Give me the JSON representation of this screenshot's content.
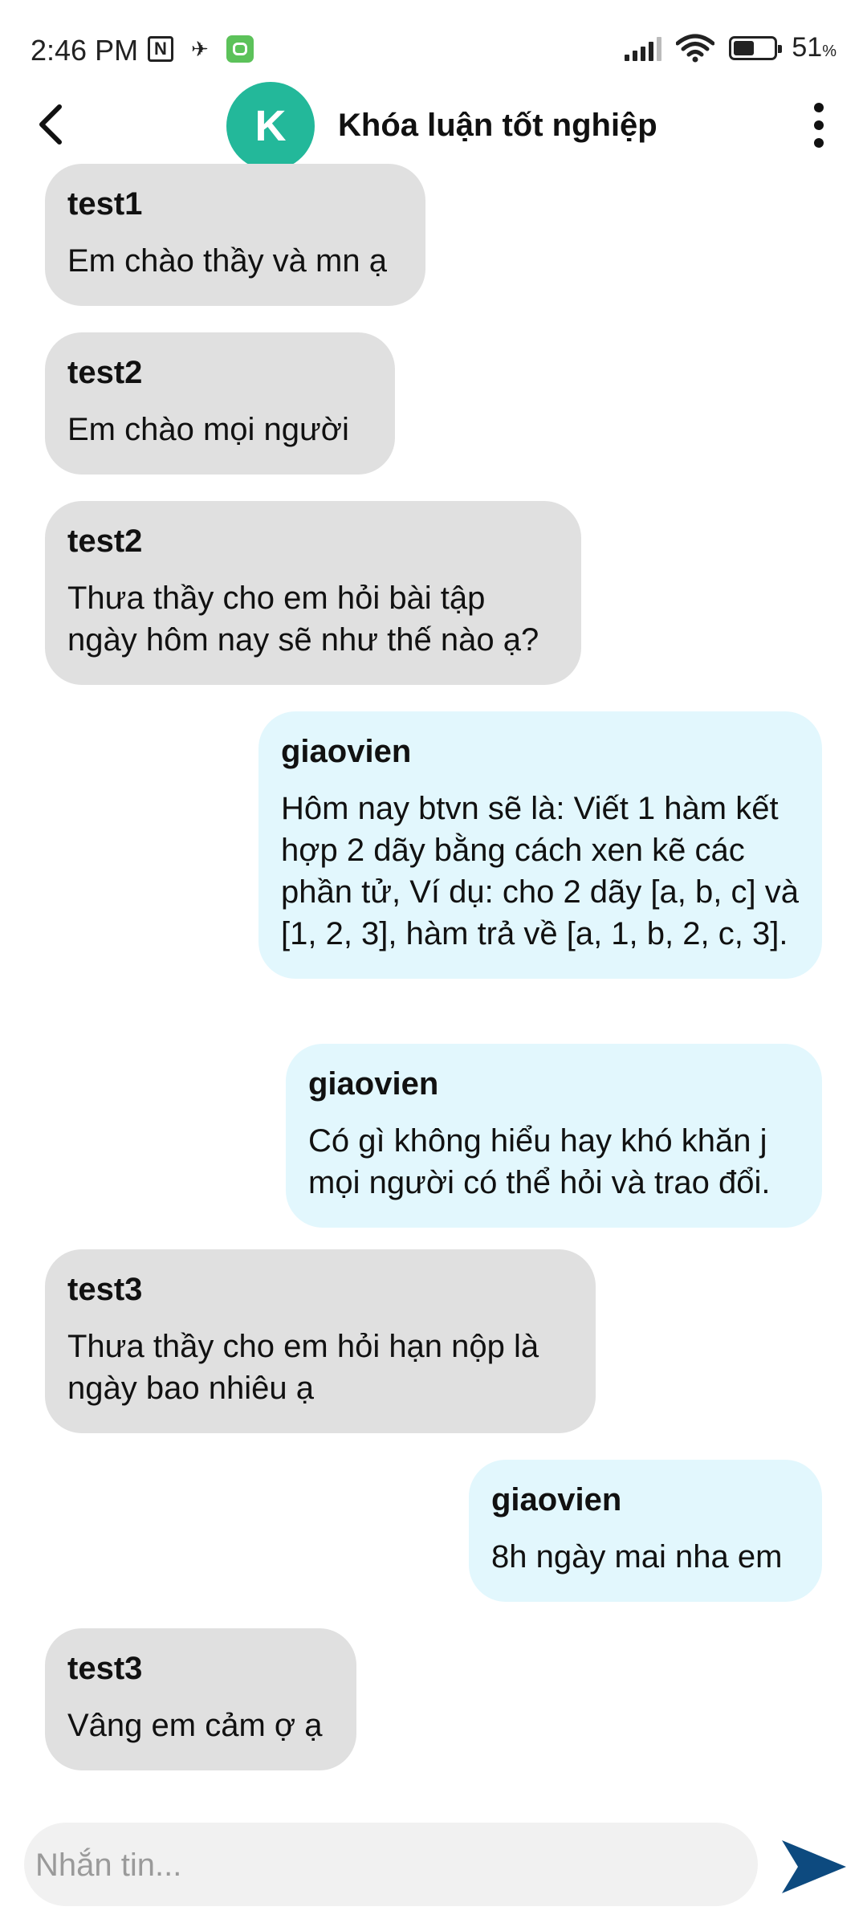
{
  "status_bar": {
    "time": "2:46 PM",
    "nfc_glyph": "N",
    "battery_percent": "51",
    "battery_unit": "%",
    "battery_level": 0.51,
    "icons": [
      "nfc-icon",
      "bird-icon",
      "app-notification-icon",
      "signal-icon",
      "wifi-icon",
      "battery-icon"
    ]
  },
  "header": {
    "avatar_letter": "K",
    "avatar_color": "#23b89a",
    "title": "Khóa luận tốt nghiệp",
    "icons": [
      "back-arrow-icon",
      "more-vert-icon"
    ]
  },
  "messages": [
    {
      "direction": "in",
      "sender": "test1",
      "text": "Em chào thầy và mn ạ"
    },
    {
      "direction": "in",
      "sender": "test2",
      "text": "Em chào mọi người"
    },
    {
      "direction": "in",
      "sender": "test2",
      "text": "Thưa thầy cho em hỏi bài tập ngày hôm nay sẽ như thế nào ạ?"
    },
    {
      "direction": "out",
      "sender": "giaovien",
      "text": "Hôm nay btvn sẽ là: Viết 1 hàm kết hợp 2 dãy bằng cách xen kẽ các phần tử, Ví dụ: cho 2 dãy [a, b, c] và [1, 2, 3], hàm trả về [a, 1, b, 2, c, 3]."
    },
    {
      "direction": "out",
      "sender": "giaovien",
      "text": "Có gì không hiểu hay khó khăn j mọi người có thể hỏi và trao đổi."
    },
    {
      "direction": "in",
      "sender": "test3",
      "text": "Thưa thầy cho em hỏi hạn nộp là ngày bao nhiêu ạ"
    },
    {
      "direction": "out",
      "sender": "giaovien",
      "text": "8h ngày mai nha em"
    },
    {
      "direction": "in",
      "sender": "test3",
      "text": "Vâng em cảm ợ ạ"
    }
  ],
  "composer": {
    "placeholder": "Nhắn tin...",
    "value": "",
    "send_icon": "send-icon",
    "send_color": "#0d4a7f"
  },
  "colors": {
    "incoming_bubble": "#e0e0e0",
    "outgoing_bubble": "#e2f7fd"
  }
}
